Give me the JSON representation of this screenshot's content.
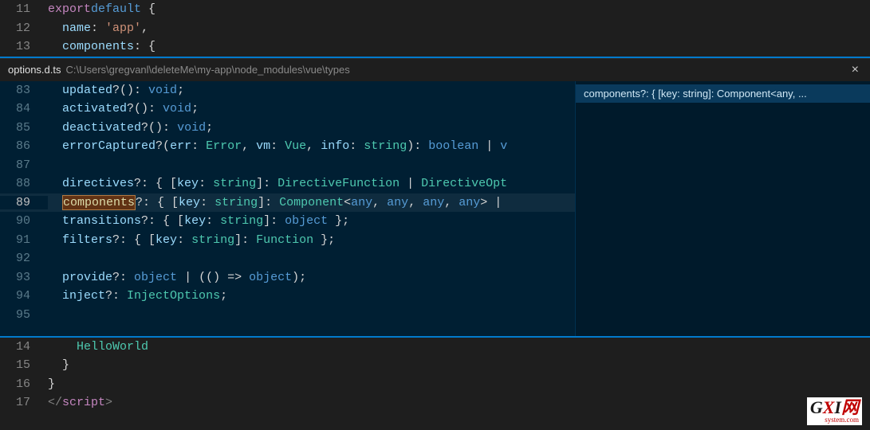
{
  "topEditor": {
    "lines": [
      {
        "num": "11",
        "indent": 0,
        "tokens": [
          [
            "k-export",
            "export"
          ],
          [
            "",
            ""
          ],
          [
            "k-default",
            "default"
          ],
          [
            "",
            " {"
          ]
        ]
      },
      {
        "num": "12",
        "indent": 1,
        "tokens": [
          [
            "",
            "  "
          ],
          [
            "k-prop",
            "name"
          ],
          [
            "punc",
            ": "
          ],
          [
            "str",
            "'app'"
          ],
          [
            "punc",
            ","
          ]
        ]
      },
      {
        "num": "13",
        "indent": 1,
        "tokens": [
          [
            "",
            "  "
          ],
          [
            "k-prop",
            "components"
          ],
          [
            "punc",
            ": {"
          ]
        ]
      }
    ]
  },
  "peek": {
    "filename": "options.d.ts",
    "path": "C:\\Users\\gregvanl\\deleteMe\\my-app\\node_modules\\vue\\types",
    "closeLabel": "×",
    "refItem": "components?: { [key: string]: Component<any, ...",
    "lines": [
      {
        "num": "83",
        "tokens": [
          [
            "",
            "  "
          ],
          [
            "k-prop",
            "updated"
          ],
          [
            "punc",
            "?(): "
          ],
          [
            "k-void",
            "void"
          ],
          [
            "punc",
            ";"
          ]
        ]
      },
      {
        "num": "84",
        "tokens": [
          [
            "",
            "  "
          ],
          [
            "k-prop",
            "activated"
          ],
          [
            "punc",
            "?(): "
          ],
          [
            "k-void",
            "void"
          ],
          [
            "punc",
            ";"
          ]
        ]
      },
      {
        "num": "85",
        "tokens": [
          [
            "",
            "  "
          ],
          [
            "k-prop",
            "deactivated"
          ],
          [
            "punc",
            "?(): "
          ],
          [
            "k-void",
            "void"
          ],
          [
            "punc",
            ";"
          ]
        ]
      },
      {
        "num": "86",
        "tokens": [
          [
            "",
            "  "
          ],
          [
            "k-prop",
            "errorCaptured"
          ],
          [
            "punc",
            "?("
          ],
          [
            "k-param",
            "err"
          ],
          [
            "punc",
            ": "
          ],
          [
            "k-type",
            "Error"
          ],
          [
            "punc",
            ", "
          ],
          [
            "k-param",
            "vm"
          ],
          [
            "punc",
            ": "
          ],
          [
            "k-type",
            "Vue"
          ],
          [
            "punc",
            ", "
          ],
          [
            "k-param",
            "info"
          ],
          [
            "punc",
            ": "
          ],
          [
            "k-string",
            "string"
          ],
          [
            "punc",
            "): "
          ],
          [
            "k-boolean",
            "boolean"
          ],
          [
            "punc",
            " | "
          ],
          [
            "k-void",
            "v"
          ]
        ]
      },
      {
        "num": "87",
        "tokens": [
          [
            "",
            ""
          ]
        ]
      },
      {
        "num": "88",
        "tokens": [
          [
            "",
            "  "
          ],
          [
            "k-prop",
            "directives"
          ],
          [
            "punc",
            "?: { ["
          ],
          [
            "k-param",
            "key"
          ],
          [
            "punc",
            ": "
          ],
          [
            "k-string",
            "string"
          ],
          [
            "punc",
            "]: "
          ],
          [
            "k-type",
            "DirectiveFunction"
          ],
          [
            "punc",
            " | "
          ],
          [
            "k-type",
            "DirectiveOpt"
          ]
        ]
      },
      {
        "num": "89",
        "current": true,
        "tokens": [
          [
            "",
            "  "
          ],
          [
            "highlight-match",
            "components"
          ],
          [
            "punc",
            "?: { ["
          ],
          [
            "k-param",
            "key"
          ],
          [
            "punc",
            ": "
          ],
          [
            "k-string",
            "string"
          ],
          [
            "punc",
            "]: "
          ],
          [
            "k-type",
            "Component"
          ],
          [
            "punc",
            "<"
          ],
          [
            "k-any",
            "any"
          ],
          [
            "punc",
            ", "
          ],
          [
            "k-any",
            "any"
          ],
          [
            "punc",
            ", "
          ],
          [
            "k-any",
            "any"
          ],
          [
            "punc",
            ", "
          ],
          [
            "k-any",
            "any"
          ],
          [
            "punc",
            "> |"
          ]
        ]
      },
      {
        "num": "90",
        "tokens": [
          [
            "",
            "  "
          ],
          [
            "k-prop",
            "transitions"
          ],
          [
            "punc",
            "?: { ["
          ],
          [
            "k-param",
            "key"
          ],
          [
            "punc",
            ": "
          ],
          [
            "k-string",
            "string"
          ],
          [
            "punc",
            "]: "
          ],
          [
            "k-object",
            "object"
          ],
          [
            "punc",
            " };"
          ]
        ]
      },
      {
        "num": "91",
        "tokens": [
          [
            "",
            "  "
          ],
          [
            "k-prop",
            "filters"
          ],
          [
            "punc",
            "?: { ["
          ],
          [
            "k-param",
            "key"
          ],
          [
            "punc",
            ": "
          ],
          [
            "k-string",
            "string"
          ],
          [
            "punc",
            "]: "
          ],
          [
            "k-func",
            "Function"
          ],
          [
            "punc",
            " };"
          ]
        ]
      },
      {
        "num": "92",
        "tokens": [
          [
            "",
            ""
          ]
        ]
      },
      {
        "num": "93",
        "tokens": [
          [
            "",
            "  "
          ],
          [
            "k-prop",
            "provide"
          ],
          [
            "punc",
            "?: "
          ],
          [
            "k-object",
            "object"
          ],
          [
            "punc",
            " | (() => "
          ],
          [
            "k-object",
            "object"
          ],
          [
            "punc",
            ");"
          ]
        ]
      },
      {
        "num": "94",
        "tokens": [
          [
            "",
            "  "
          ],
          [
            "k-prop",
            "inject"
          ],
          [
            "punc",
            "?: "
          ],
          [
            "k-type",
            "InjectOptions"
          ],
          [
            "punc",
            ";"
          ]
        ]
      },
      {
        "num": "95",
        "tokens": [
          [
            "",
            ""
          ]
        ]
      }
    ]
  },
  "bottomEditor": {
    "lines": [
      {
        "num": "14",
        "indent": 2,
        "tokens": [
          [
            "",
            "    "
          ],
          [
            "k-type",
            "HelloWorld"
          ]
        ]
      },
      {
        "num": "15",
        "indent": 1,
        "tokens": [
          [
            "",
            "  }"
          ]
        ]
      },
      {
        "num": "16",
        "indent": 0,
        "tokens": [
          [
            "",
            "}"
          ]
        ]
      },
      {
        "num": "17",
        "indent": 0,
        "tokens": [
          [
            "tag",
            "</"
          ],
          [
            "k-export",
            "script"
          ],
          [
            "tag",
            ">"
          ]
        ]
      }
    ]
  },
  "watermark": {
    "prefix": "G",
    "mid": "X",
    "suffix": "I",
    "cn": "网",
    "domain": "system.com"
  }
}
